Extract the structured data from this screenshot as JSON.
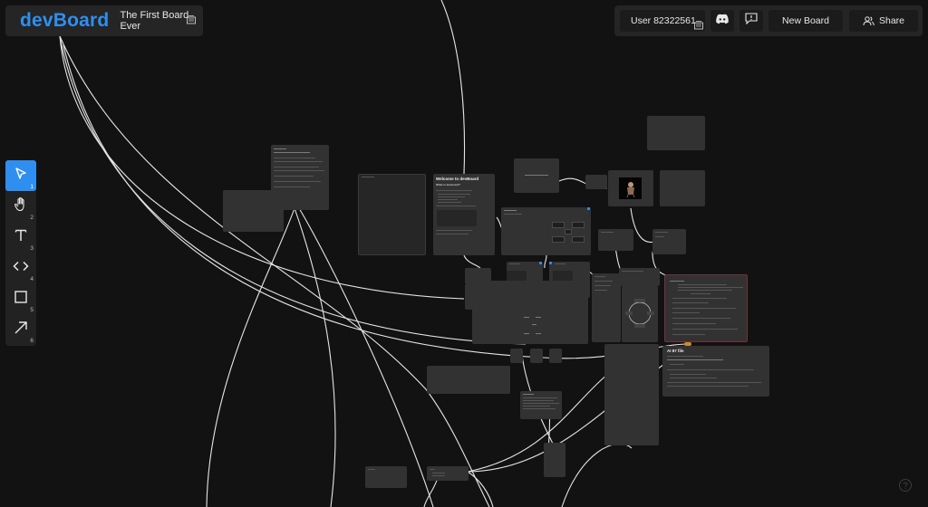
{
  "brand": {
    "logo": "devBoard",
    "board_title": "The First Board Ever",
    "edit_icon": "edit-icon"
  },
  "topbar": {
    "user_label": "User 82322561",
    "discord_icon": "discord-icon",
    "feedback_icon": "feedback-icon",
    "new_board_label": "New Board",
    "share_label": "Share",
    "share_icon": "users-icon"
  },
  "toolbar": {
    "tools": [
      {
        "name": "select",
        "icon": "pointer-icon",
        "shortcut": "1",
        "active": true
      },
      {
        "name": "pan",
        "icon": "hand-icon",
        "shortcut": "2",
        "active": false
      },
      {
        "name": "text",
        "icon": "text-icon",
        "shortcut": "3",
        "active": false
      },
      {
        "name": "code",
        "icon": "code-icon",
        "shortcut": "4",
        "active": false
      },
      {
        "name": "rectangle",
        "icon": "square-icon",
        "shortcut": "5",
        "active": false
      },
      {
        "name": "arrow",
        "icon": "arrow-icon",
        "shortcut": "6",
        "active": false
      }
    ]
  },
  "board": {
    "welcome_title": "Welcome to devBoard",
    "welcome_subtitle": "What is devboard?",
    "ai_title": "AI 87 file",
    "help_icon": "help-icon"
  },
  "colors": {
    "background": "#121212",
    "panel": "#252525",
    "accent": "#2f8ff0",
    "node": "#2e2e2e",
    "wire": "#e8e8e8"
  }
}
